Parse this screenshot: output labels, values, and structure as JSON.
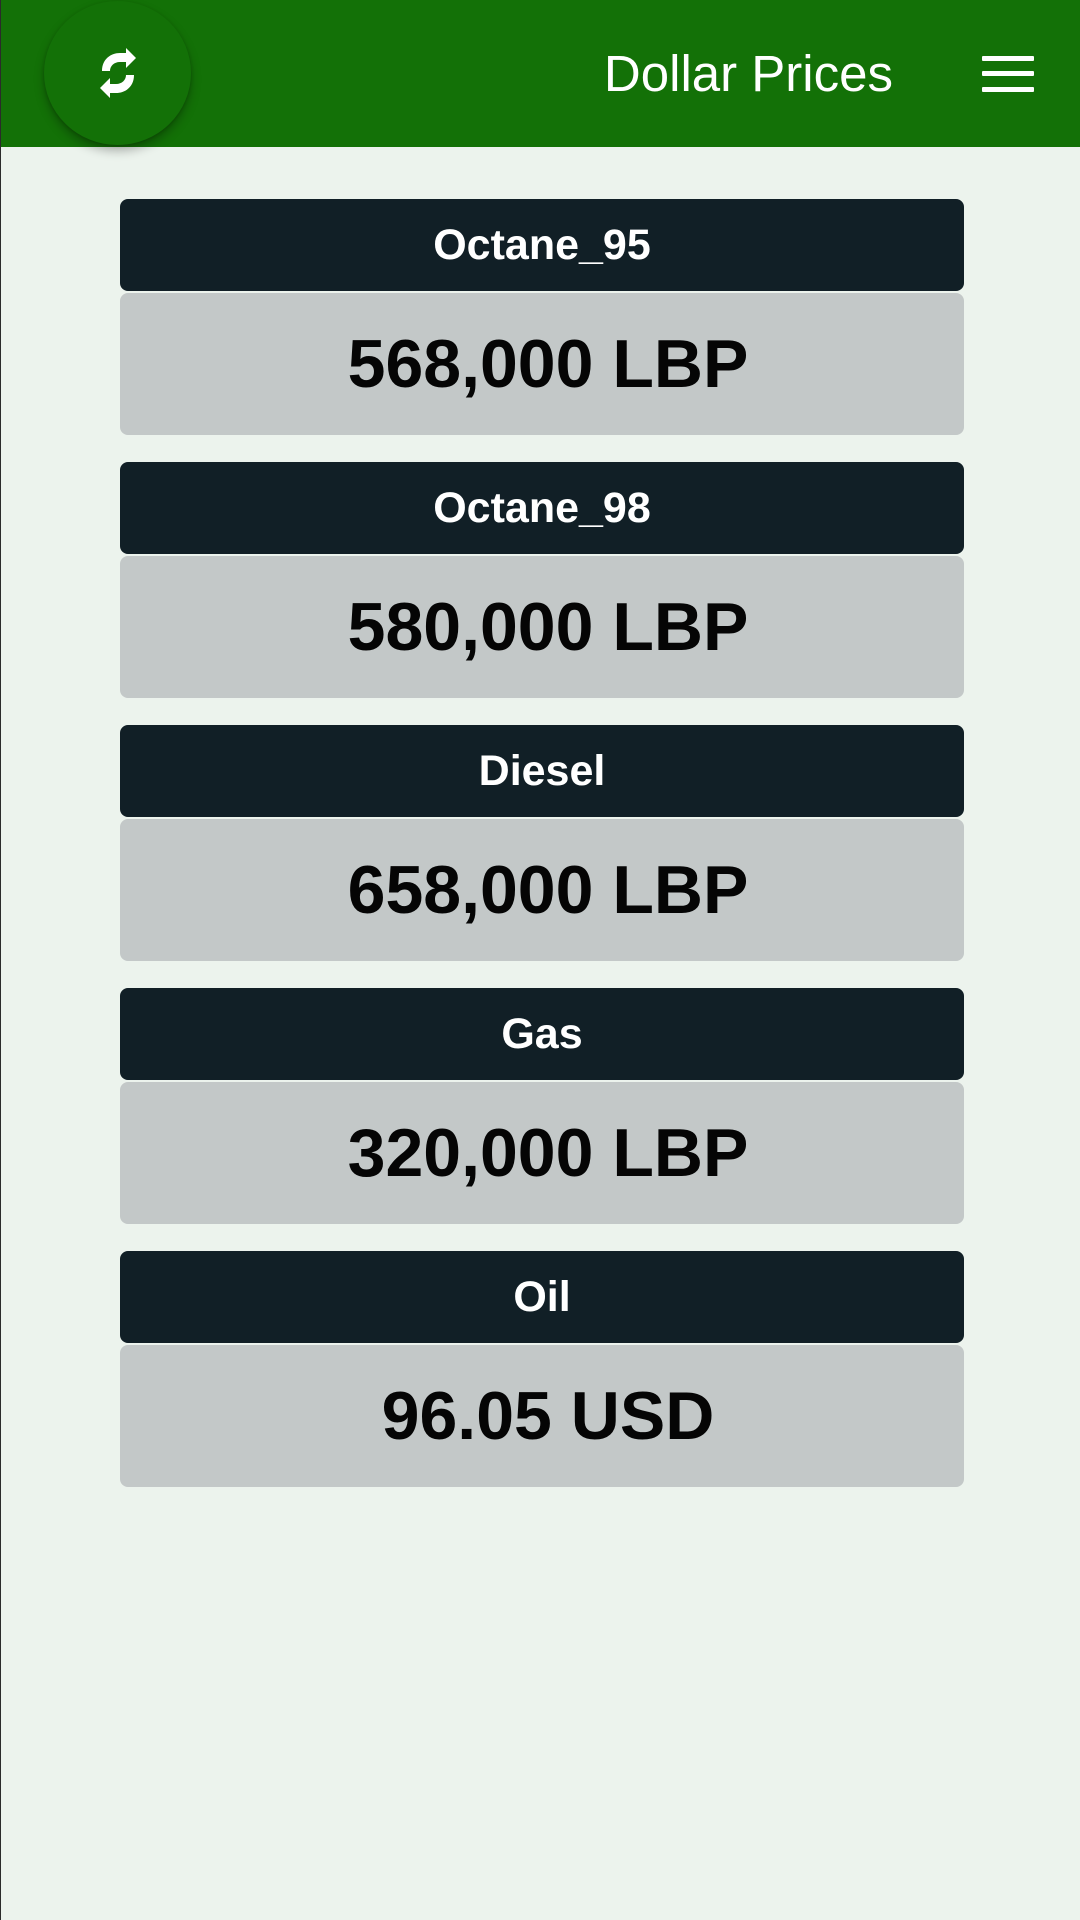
{
  "app_bar": {
    "title": "Dollar Prices",
    "refresh_icon": "refresh-icon",
    "menu_icon": "hamburger-menu-icon",
    "color": "#137107"
  },
  "prices": [
    {
      "name": "Octane_95",
      "value": "568,000 LBP"
    },
    {
      "name": "Octane_98",
      "value": "580,000 LBP"
    },
    {
      "name": "Diesel",
      "value": "658,000 LBP"
    },
    {
      "name": "Gas",
      "value": "320,000 LBP"
    },
    {
      "name": "Oil",
      "value": "96.05 USD"
    }
  ]
}
